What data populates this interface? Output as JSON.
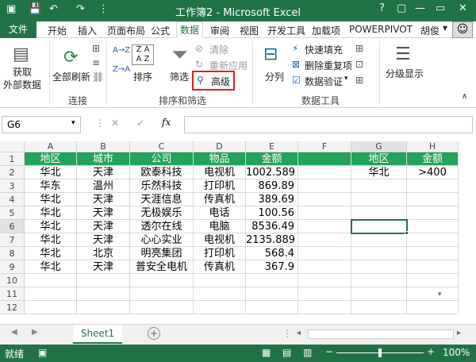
{
  "window": {
    "title": "工作簿2 - Microsoft Excel",
    "controls": [
      "?",
      "▢",
      "—",
      "▭",
      "✕"
    ]
  },
  "tabs": {
    "file": "文件",
    "items": [
      "开始",
      "插入",
      "页面布局",
      "公式",
      "数据",
      "审阅",
      "视图",
      "开发工具",
      "加载项",
      "POWERPIVOT"
    ],
    "active": "数据",
    "user": "胡俊"
  },
  "ribbon": {
    "get_external": "获取",
    "get_external_2": "外部数据",
    "refresh_all": "全部刷新",
    "group_connections": "连接",
    "sort": "排序",
    "filter": "筛选",
    "clear": "清除",
    "reapply": "重新应用",
    "advanced": "高级",
    "group_sort_filter": "排序和筛选",
    "split": "分列",
    "flash_fill": "快速填充",
    "remove_dup": "删除重复项",
    "validation": "数据验证",
    "group_data_tools": "数据工具",
    "outline": "分级显示",
    "sort_az": "A→Z",
    "sort_za": "Z→A"
  },
  "formula_bar": {
    "name_box": "G6",
    "fx": "fx",
    "formula": ""
  },
  "grid": {
    "columns": [
      "A",
      "B",
      "C",
      "D",
      "E",
      "F",
      "G",
      "H"
    ],
    "rows": [
      "1",
      "2",
      "3",
      "4",
      "5",
      "6",
      "7",
      "8",
      "9",
      "10",
      "11",
      "12"
    ],
    "header_row": [
      "地区",
      "城市",
      "公司",
      "物品",
      "金额",
      "",
      "地区",
      "金额"
    ],
    "data": [
      [
        "华北",
        "天津",
        "欧泰科技",
        "电视机",
        "1002.589",
        "",
        "华北",
        ">400"
      ],
      [
        "华东",
        "温州",
        "乐然科技",
        "打印机",
        "869.89",
        "",
        "",
        ""
      ],
      [
        "华北",
        "天津",
        "天涯信息",
        "传真机",
        "389.69",
        "",
        "",
        ""
      ],
      [
        "华北",
        "天津",
        "无极娱乐",
        "电话",
        "100.56",
        "",
        "",
        ""
      ],
      [
        "华北",
        "天津",
        "透尔在线",
        "电脑",
        "8536.49",
        "",
        "",
        ""
      ],
      [
        "华北",
        "天津",
        "心心实业",
        "电视机",
        "2135.889",
        "",
        "",
        ""
      ],
      [
        "华北",
        "北京",
        "明亮集团",
        "打印机",
        "568.4",
        "",
        "",
        ""
      ],
      [
        "华北",
        "天津",
        "普安全电机",
        "传真机",
        "367.9",
        "",
        "",
        ""
      ]
    ]
  },
  "sheets": {
    "active": "Sheet1",
    "add": "+"
  },
  "status": {
    "mode": "就绪",
    "zoom": "100%",
    "zoom_minus": "−",
    "zoom_plus": "+"
  },
  "colors": {
    "brand": "#217346",
    "header_fill": "#21a35a",
    "highlight": "#e02020"
  }
}
